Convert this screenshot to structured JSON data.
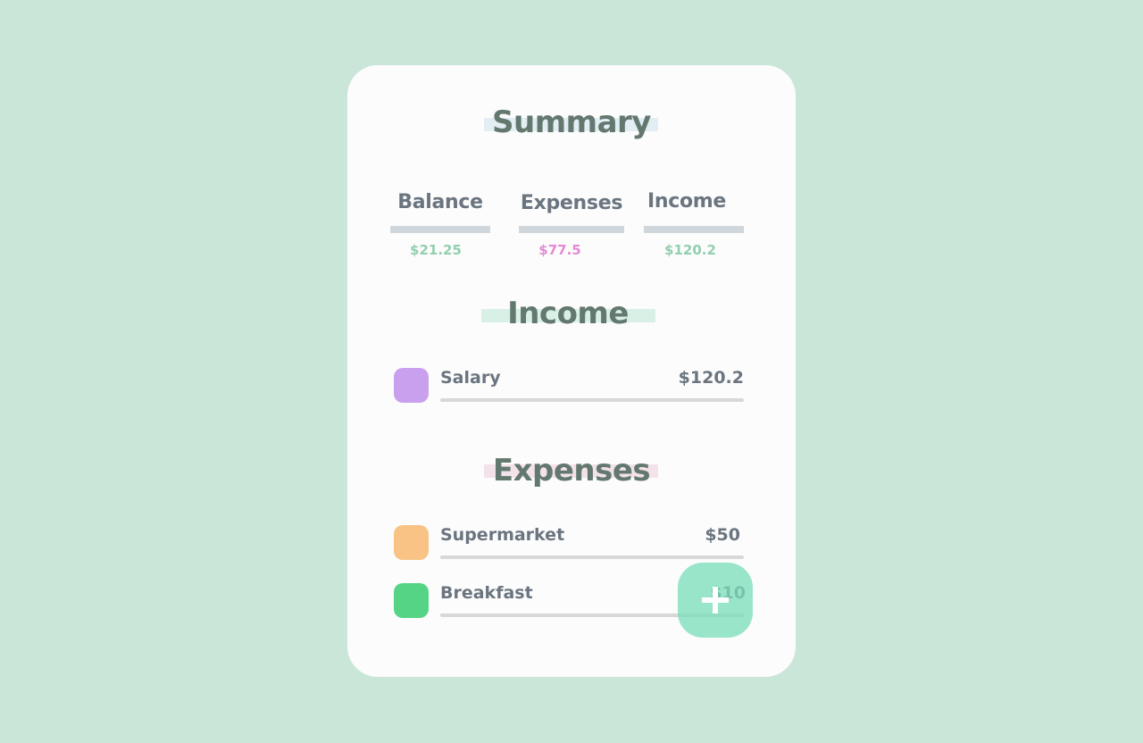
{
  "summary": {
    "title": "Summary",
    "stats": [
      {
        "label": "Balance",
        "value": "$21.25",
        "color": "#92cfae"
      },
      {
        "label": "Expenses",
        "value": "$77.5",
        "color": "#e48ad4"
      },
      {
        "label": "Income",
        "value": "$120.2",
        "color": "#92cfae"
      }
    ]
  },
  "income": {
    "title": "Income",
    "items": [
      {
        "label": "Salary",
        "amount": "$120.2",
        "color": "#c9a0ee"
      }
    ]
  },
  "expenses": {
    "title": "Expenses",
    "items": [
      {
        "label": "Supermarket",
        "amount": "$50",
        "color": "#f8c385"
      },
      {
        "label": "Breakfast",
        "amount": "$10",
        "color": "#55d486"
      }
    ]
  },
  "fab": {
    "icon": "plus-icon",
    "color": "#78deba"
  },
  "colors": {
    "background": "#cae6d8",
    "card": "#fcfcfc",
    "summary_highlight": "#e3edf4",
    "income_highlight": "#d8f0e6",
    "expenses_highlight": "#f3e2ea"
  }
}
